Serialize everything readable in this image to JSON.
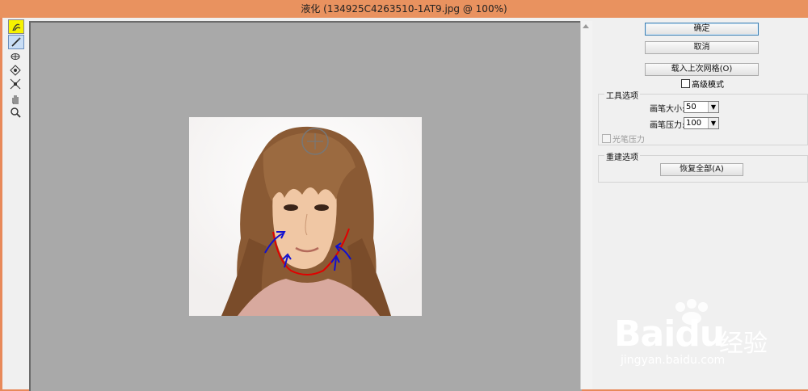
{
  "window": {
    "title": "液化 (134925C4263510-1AT9.jpg @ 100%)"
  },
  "tools": [
    {
      "name": "forward-warp-tool",
      "icon": "warp-icon"
    },
    {
      "name": "reconstruct-tool",
      "icon": "brush-icon"
    },
    {
      "name": "pucker-tool",
      "icon": "pucker-icon"
    },
    {
      "name": "bloat-tool",
      "icon": "bloat-icon"
    },
    {
      "name": "push-left-tool",
      "icon": "push-icon"
    },
    {
      "name": "hand-tool",
      "icon": "hand-icon"
    },
    {
      "name": "zoom-tool",
      "icon": "zoom-icon"
    }
  ],
  "buttons": {
    "ok": "确定",
    "cancel": "取消",
    "load_mesh": "载入上次网格(O)",
    "restore_all": "恢复全部(A)"
  },
  "advanced_mode": {
    "label": "高级模式",
    "checked": false
  },
  "tool_options": {
    "title": "工具选项",
    "brush_size_label": "画笔大小:",
    "brush_size_value": "50",
    "brush_pressure_label": "画笔压力:",
    "brush_pressure_value": "100",
    "stylus_pressure_label": "光笔压力"
  },
  "reconstruct_options": {
    "title": "重建选项"
  },
  "watermark": {
    "brand_a": "Bai",
    "brand_b": "du",
    "cn": "经验",
    "url": "jingyan.baidu.com"
  }
}
